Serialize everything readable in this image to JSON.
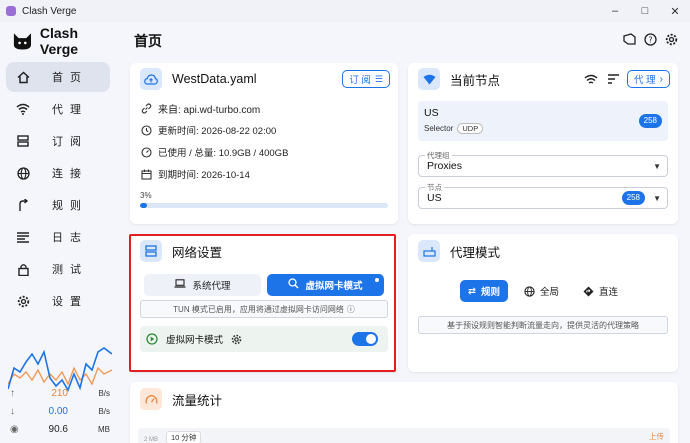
{
  "window": {
    "title": "Clash Verge"
  },
  "app": {
    "name": "Clash Verge"
  },
  "nav": [
    {
      "label": "首 页",
      "icon": "home-icon",
      "active": true
    },
    {
      "label": "代 理",
      "icon": "wifi-icon"
    },
    {
      "label": "订 阅",
      "icon": "storage-icon"
    },
    {
      "label": "连 接",
      "icon": "globe-icon"
    },
    {
      "label": "规 则",
      "icon": "fork-icon"
    },
    {
      "label": "日 志",
      "icon": "list-icon"
    },
    {
      "label": "测 试",
      "icon": "lock-icon"
    },
    {
      "label": "设 置",
      "icon": "gear-icon"
    }
  ],
  "traffic": {
    "upload": {
      "value": "210",
      "unit": "B/s"
    },
    "download": {
      "value": "0.00",
      "unit": "B/s"
    },
    "memory": {
      "value": "90.6",
      "unit": "MB"
    }
  },
  "header": {
    "title": "首页"
  },
  "profile": {
    "name": "WestData.yaml",
    "button": "订 阅",
    "source": "来自: api.wd-turbo.com",
    "updated": "更新时间: 2026-08-22 02:00",
    "usage": "已使用 / 总量: 10.9GB / 400GB",
    "expire": "到期时间: 2026-10-14",
    "percent_label": "3%",
    "percent": 0.03
  },
  "current_node": {
    "title": "当前节点",
    "button": "代 理",
    "node_name": "US",
    "node_type": "Selector",
    "udp": "UDP",
    "delay": "258",
    "group_label": "代理组",
    "group_value": "Proxies",
    "node_label": "节点",
    "node_value": "US",
    "node_delay": "258"
  },
  "network": {
    "title": "网络设置",
    "system_proxy": "系统代理",
    "tun_mode": "虚拟网卡模式",
    "hint": "TUN 模式已启用，应用将通过虚拟网卡访问网络",
    "toggle_label": "虚拟网卡模式"
  },
  "proxy_mode": {
    "title": "代理模式",
    "rule": "规则",
    "global": "全局",
    "direct": "直连",
    "desc": "基于预设规则智能判断流量走向，提供灵活的代理策略"
  },
  "traffic_stats": {
    "title": "流量统计",
    "range": "10 分钟",
    "axis": "2 MB",
    "legend": "上传"
  },
  "colors": {
    "accent": "#1d73e8",
    "highlight": "#e02020"
  }
}
